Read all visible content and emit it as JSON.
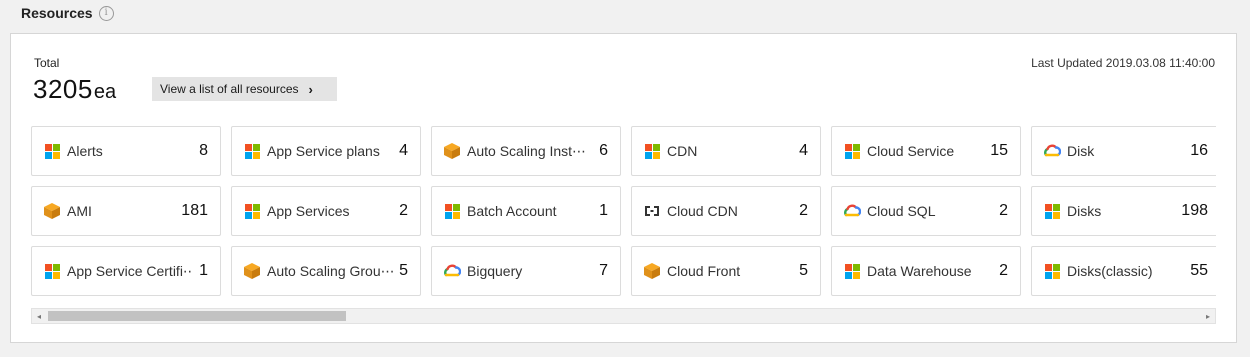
{
  "section": {
    "title": "Resources",
    "info_icon": "info-icon",
    "info_glyph": "i"
  },
  "summary": {
    "total_label": "Total",
    "total_value": "3205",
    "total_unit": "ea",
    "view_all_label": "View a list of all resources",
    "view_all_icon": "chevron-right-icon",
    "last_updated": "Last Updated 2019.03.08 11:40:00"
  },
  "resources": [
    {
      "name": "Alerts",
      "count": "8",
      "icon": "azure-icon"
    },
    {
      "name": "AMI",
      "count": "181",
      "icon": "aws-icon"
    },
    {
      "name": "App Service Certifi⋯",
      "count": "1",
      "icon": "azure-icon"
    },
    {
      "name": "App Service plans",
      "count": "4",
      "icon": "azure-icon"
    },
    {
      "name": "App Services",
      "count": "2",
      "icon": "azure-icon"
    },
    {
      "name": "Auto Scaling Grou⋯",
      "count": "5",
      "icon": "aws-icon"
    },
    {
      "name": "Auto Scaling Inst⋯",
      "count": "6",
      "icon": "aws-icon"
    },
    {
      "name": "Batch Account",
      "count": "1",
      "icon": "azure-icon"
    },
    {
      "name": "Bigquery",
      "count": "7",
      "icon": "gcp-icon"
    },
    {
      "name": "CDN",
      "count": "4",
      "icon": "azure-icon"
    },
    {
      "name": "Cloud CDN",
      "count": "2",
      "icon": "cloud-cdn-icon"
    },
    {
      "name": "Cloud Front",
      "count": "5",
      "icon": "aws-icon"
    },
    {
      "name": "Cloud Service",
      "count": "15",
      "icon": "azure-icon"
    },
    {
      "name": "Cloud SQL",
      "count": "2",
      "icon": "gcp-icon"
    },
    {
      "name": "Data Warehouse",
      "count": "2",
      "icon": "azure-icon"
    },
    {
      "name": "Disk",
      "count": "16",
      "icon": "gcp-icon"
    },
    {
      "name": "Disks",
      "count": "198",
      "icon": "azure-icon"
    },
    {
      "name": "Disks(classic)",
      "count": "55",
      "icon": "azure-icon"
    }
  ],
  "colors": {
    "azure": [
      "#f25022",
      "#7fba00",
      "#00a4ef",
      "#ffb900"
    ],
    "aws": "#f7a823",
    "gcp": [
      "#4285f4",
      "#ea4335",
      "#fbbc05",
      "#34a853"
    ],
    "cdn": "#333333"
  },
  "scrollbar": {
    "left_arrow": "◂",
    "right_arrow": "▸",
    "position": 0
  }
}
